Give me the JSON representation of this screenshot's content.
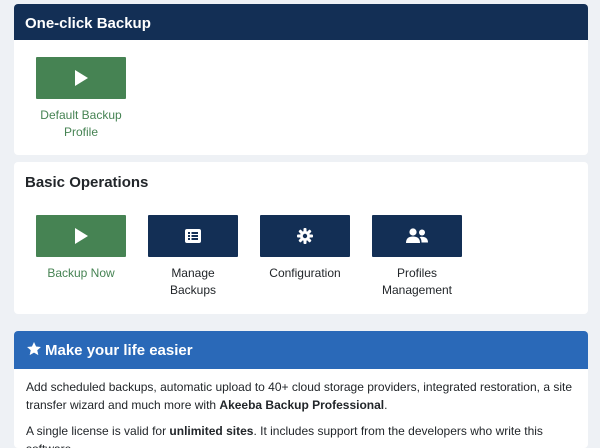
{
  "one_click": {
    "title": "One-click Backup",
    "items": [
      {
        "label": "Default Backup Profile",
        "icon": "play-icon",
        "color": "#468353"
      }
    ]
  },
  "basic_ops": {
    "title": "Basic Operations",
    "items": [
      {
        "label": "Backup Now",
        "icon": "play-icon",
        "color": "#468353"
      },
      {
        "label": "Manage Backups",
        "icon": "list-icon",
        "color": "#132f55"
      },
      {
        "label": "Configuration",
        "icon": "gear-icon",
        "color": "#132f55"
      },
      {
        "label": "Profiles Management",
        "icon": "users-icon",
        "color": "#132f55"
      }
    ]
  },
  "promo": {
    "title": "Make your life easier",
    "icon": "star-icon",
    "para1_prefix": "Add scheduled backups, automatic upload to 40+ cloud storage providers, integrated restoration, a site transfer wizard and much more with ",
    "para1_bold": "Akeeba Backup Professional",
    "para1_suffix": ".",
    "para2_prefix": "A single license is valid for ",
    "para2_bold": "unlimited sites",
    "para2_suffix": ". It includes support from the developers who write this software."
  },
  "colors": {
    "header_navy": "#132f55",
    "accent_green": "#468353",
    "promo_blue": "#2a69b8",
    "page_bg": "#eef1f5"
  }
}
